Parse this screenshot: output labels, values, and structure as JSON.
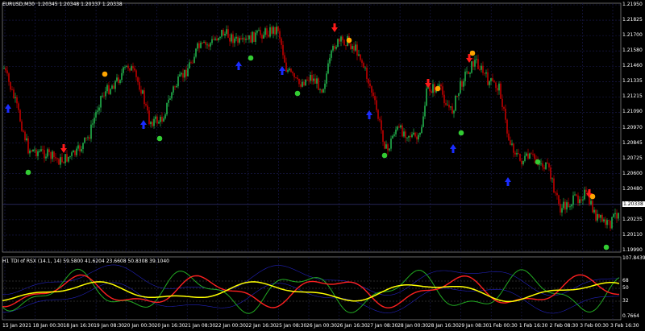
{
  "main_header": "EURUSD,M30  1.20345 1.20348 1.20337 1.20338",
  "indicator_header": "H1 TDI of RSX (14.1, 14) 59.5800 41.6204 23.6608 50.8308 39.1040",
  "price_axis": [
    "1.21950",
    "1.21825",
    "1.21700",
    "1.21580",
    "1.21460",
    "1.21335",
    "1.21215",
    "1.21090",
    "1.20970",
    "1.20845",
    "1.20725",
    "1.20600",
    "1.20480",
    "1.20338",
    "1.20235",
    "1.20110",
    "1.19990"
  ],
  "indicator_axis": [
    "107.8439",
    "68",
    "50",
    "32",
    "0.7664"
  ],
  "time_axis": [
    "15 Jan 2021",
    "18 Jan 00:30",
    "18 Jan 16:30",
    "19 Jan 08:30",
    "20 Jan 00:30",
    "20 Jan 16:30",
    "21 Jan 08:30",
    "22 Jan 00:30",
    "22 Jan 16:30",
    "25 Jan 08:30",
    "26 Jan 00:30",
    "26 Jan 16:30",
    "27 Jan 08:30",
    "28 Jan 00:30",
    "28 Jan 16:30",
    "29 Jan 08:30",
    "1 Feb 00:30",
    "1 Feb 16:30",
    "2 Feb 08:30",
    "3 Feb 00:30",
    "3 Feb 16:30"
  ],
  "colors": {
    "bull": "#22b14c",
    "bear": "#c00000",
    "up_arrow": "#1a2cff",
    "down_arrow": "#ff1a1a",
    "buy_dot": "#33cc33",
    "sell_dot": "#ffa500",
    "tdi_yellow": "#ffff00",
    "tdi_red": "#ff2020",
    "tdi_green": "#22aa22",
    "tdi_band": "#2222bb"
  }
}
